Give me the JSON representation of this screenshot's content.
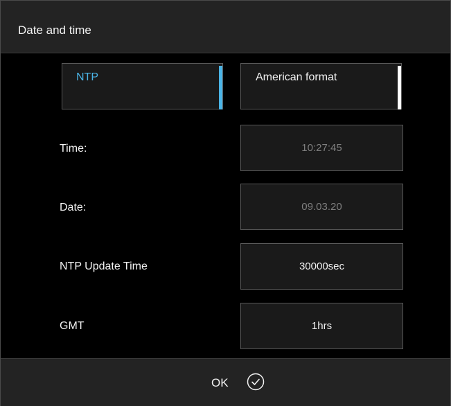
{
  "dialog": {
    "title": "Date and time"
  },
  "toggles": {
    "ntp": {
      "label": "NTP",
      "active": true,
      "accent": "#4ab4e6"
    },
    "format": {
      "label": "American format",
      "active": true,
      "accent": "#ffffff"
    }
  },
  "fields": {
    "time": {
      "label": "Time:",
      "value": "10:27:45",
      "enabled": false
    },
    "date": {
      "label": "Date:",
      "value": "09.03.20",
      "enabled": false
    },
    "ntp_update": {
      "label": "NTP Update Time",
      "value": "30000sec",
      "enabled": true
    },
    "gmt": {
      "label": "GMT",
      "value": "1hrs",
      "enabled": true
    }
  },
  "footer": {
    "ok_label": "OK",
    "ok_icon": "check-circle-icon"
  },
  "colors": {
    "background": "#000000",
    "panel": "#232323",
    "accent": "#4ab4e6",
    "disabled_text": "#7f7f7f"
  }
}
